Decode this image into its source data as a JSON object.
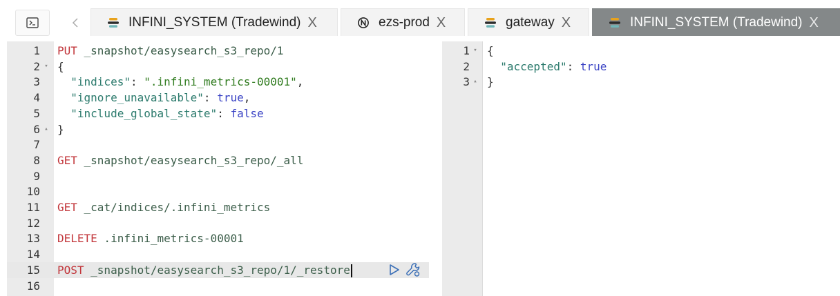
{
  "toolbar": {
    "console_icon": "terminal-icon",
    "prev_icon": "chevron-left-icon"
  },
  "tabs": [
    {
      "label": "INFINI_SYSTEM (Tradewind)",
      "icon": "easysearch-logo-icon",
      "close": "X",
      "active": false
    },
    {
      "label": "ezs-prod",
      "icon": "cluster-logo-icon",
      "close": "X",
      "active": false
    },
    {
      "label": "gateway",
      "icon": "easysearch-logo-icon",
      "close": "X",
      "active": false
    },
    {
      "label": "INFINI_SYSTEM (Tradewind)",
      "icon": "easysearch-logo-icon",
      "close": "X",
      "active": true
    }
  ],
  "request_editor": {
    "active_line": 15,
    "lines": [
      {
        "num": "1",
        "method": "PUT",
        "path": " _snapshot/easysearch_s3_repo/1"
      },
      {
        "num": "2",
        "fold": "▾",
        "punct": "{"
      },
      {
        "num": "3",
        "key": "  \"indices\"",
        "sep": ": ",
        "str": "\".infini_metrics-00001\"",
        "tail": ","
      },
      {
        "num": "4",
        "key": "  \"ignore_unavailable\"",
        "sep": ": ",
        "bool": "true",
        "tail": ","
      },
      {
        "num": "5",
        "key": "  \"include_global_state\"",
        "sep": ": ",
        "bool": "false"
      },
      {
        "num": "6",
        "fold": "▴",
        "punct": "}"
      },
      {
        "num": "7"
      },
      {
        "num": "8",
        "method": "GET",
        "path": " _snapshot/easysearch_s3_repo/_all"
      },
      {
        "num": "9"
      },
      {
        "num": "10"
      },
      {
        "num": "11",
        "method": "GET",
        "path": " _cat/indices/.infini_metrics"
      },
      {
        "num": "12"
      },
      {
        "num": "13",
        "method": "DELETE",
        "path": " .infini_metrics-00001"
      },
      {
        "num": "14"
      },
      {
        "num": "15",
        "method": "POST",
        "path": " _snapshot/easysearch_s3_repo/1/_restore"
      },
      {
        "num": "16"
      }
    ],
    "actions": {
      "run_icon": "play-icon",
      "wrench_icon": "wrench-icon"
    }
  },
  "response_editor": {
    "lines": [
      {
        "num": "1",
        "fold": "▾",
        "punct": "{"
      },
      {
        "num": "2",
        "key": "  \"accepted\"",
        "sep": ": ",
        "bool": "true"
      },
      {
        "num": "3",
        "fold": "▴",
        "punct": "}"
      }
    ]
  },
  "colors": {
    "method": "#c2363b",
    "key": "#2b7a6c",
    "string": "#2f7b1e",
    "boolean": "#3b44c5",
    "active_tab": "#848889"
  }
}
